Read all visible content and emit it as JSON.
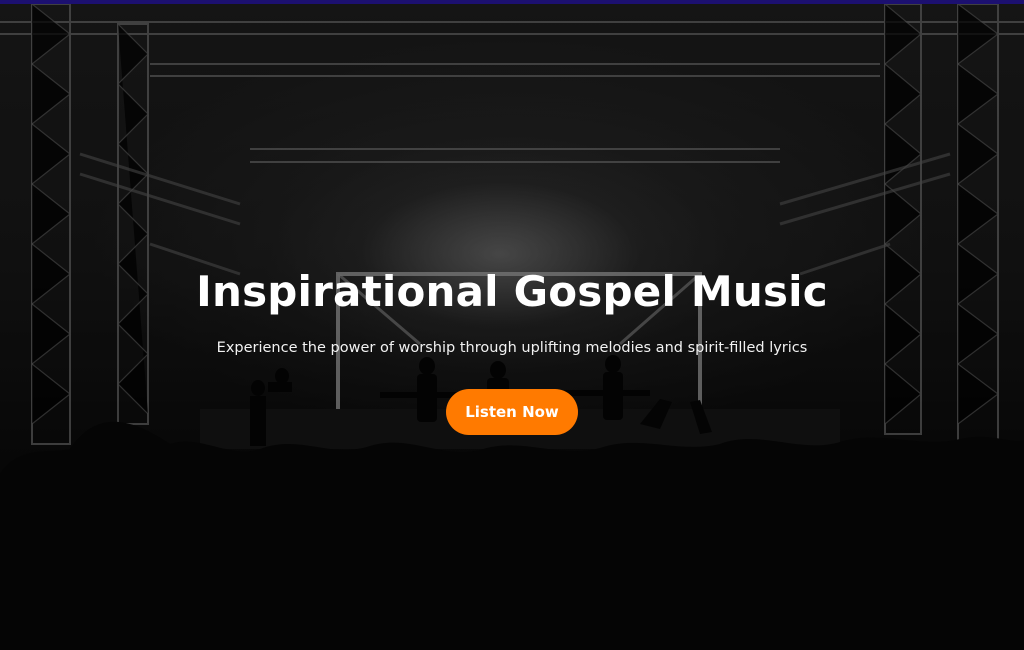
{
  "theme": {
    "top_strip_color": "#1c1070",
    "accent_color": "#ff7a00"
  },
  "hero": {
    "background_image": "concert-stage-silhouette",
    "title": "Inspirational Gospel Music",
    "subtitle": "Experience the power of worship through uplifting melodies and spirit-filled lyrics",
    "cta_label": "Listen Now"
  }
}
